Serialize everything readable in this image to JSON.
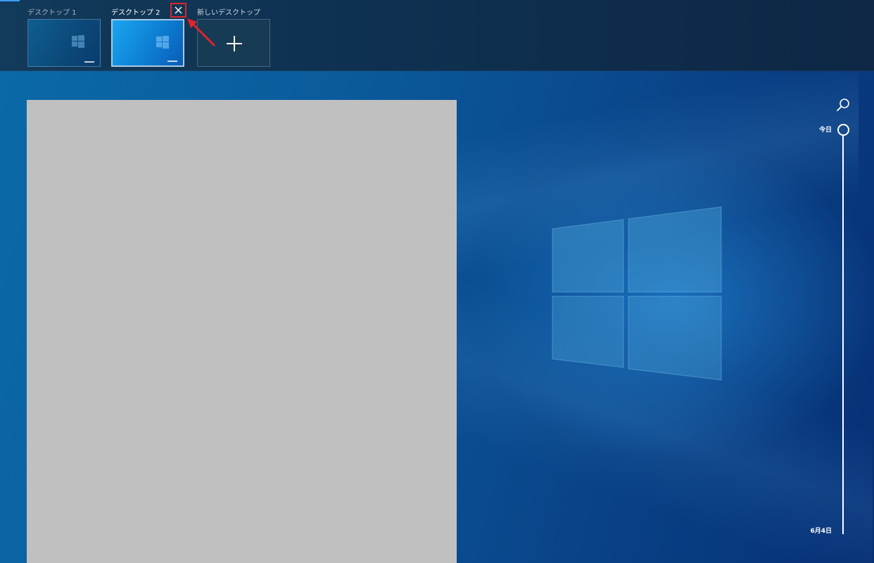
{
  "task_view": {
    "desktops": [
      {
        "label": "デスクトップ 1",
        "state": "inactive"
      },
      {
        "label": "デスクトップ 2",
        "state": "selected"
      },
      {
        "label": "新しいデスクトップ",
        "state": "add"
      }
    ],
    "close_button": "×"
  },
  "timeline": {
    "top_label": "今日",
    "bottom_label": "6月4日"
  },
  "colors": {
    "accent": "#3aa0ff",
    "highlight": "#e0242b",
    "placeholder": "#c0c0c0"
  },
  "icons": [
    "close-icon",
    "plus-icon",
    "search-icon",
    "windows-logo-icon",
    "annotation-arrow-icon"
  ]
}
